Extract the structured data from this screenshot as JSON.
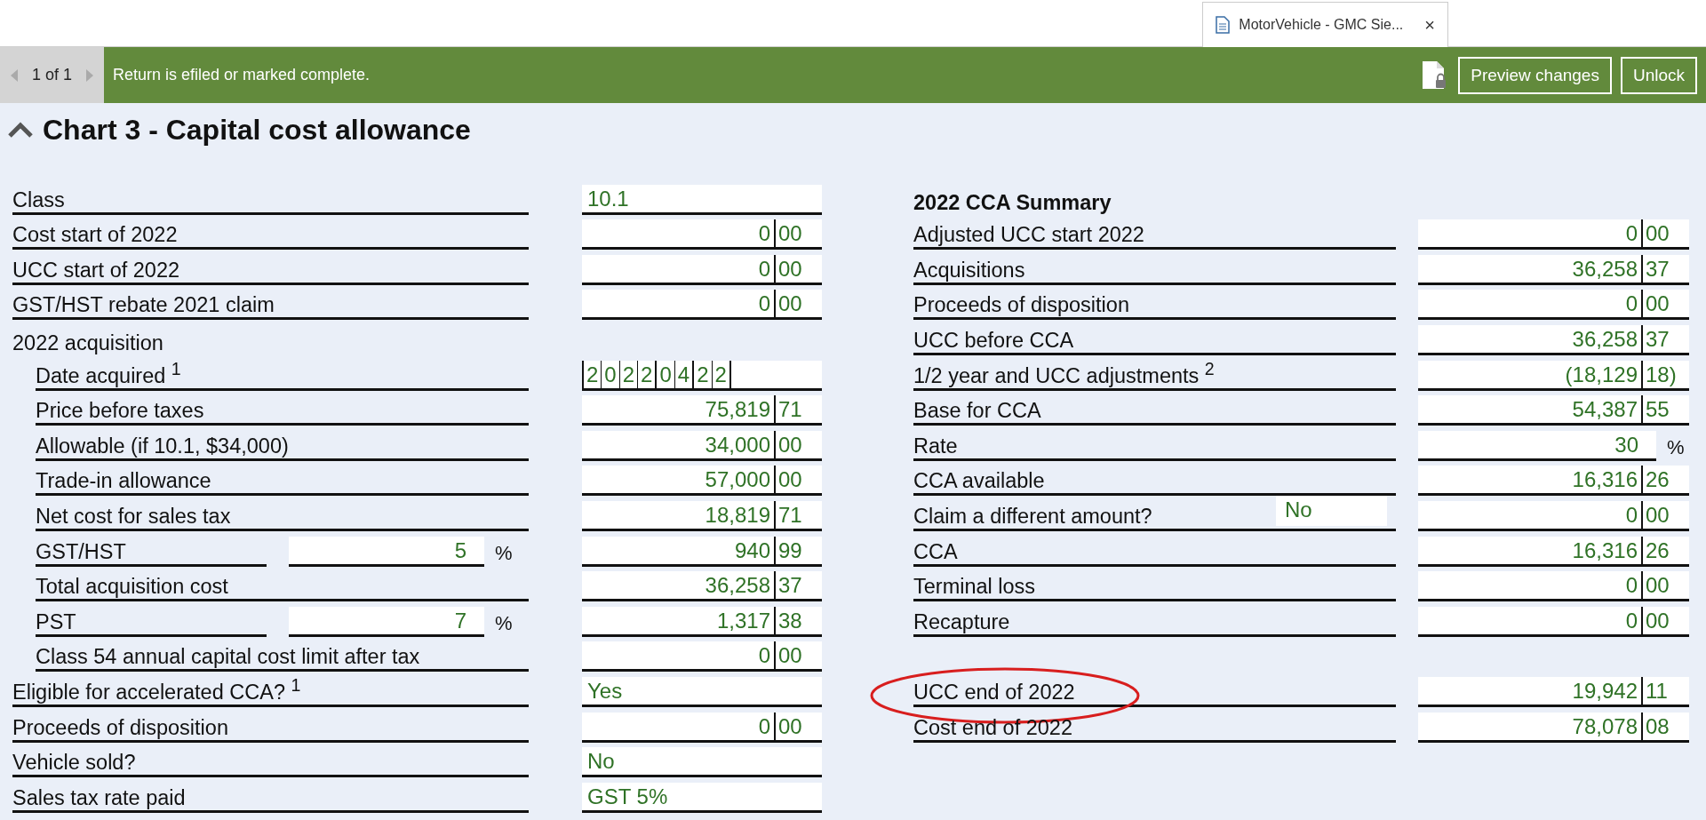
{
  "tab": {
    "title": "MotorVehicle - GMC Sie...",
    "close": "×"
  },
  "status_bar": {
    "pager": "1 of 1",
    "message": "Return is efiled or marked complete.",
    "buttons": [
      "Preview changes",
      "Unlock"
    ]
  },
  "form": {
    "title": "Chart 3 - Capital cost allowance",
    "expanded": true,
    "left_rows": [
      {
        "kind": "text",
        "label": "Class",
        "indent": false,
        "value": "10.1"
      },
      {
        "kind": "amount",
        "label": "Cost start of 2022",
        "indent": false,
        "dollars": "0",
        "cents": "00"
      },
      {
        "kind": "amount",
        "label": "UCC start of 2022",
        "indent": false,
        "dollars": "0",
        "cents": "00"
      },
      {
        "kind": "amount",
        "label": "GST/HST rebate 2021 claim",
        "indent": false,
        "dollars": "0",
        "cents": "00"
      },
      {
        "kind": "heading",
        "label": "2022 acquisition",
        "indent": false
      },
      {
        "kind": "date",
        "label": "Date acquired $^{1}$",
        "indent": true,
        "groups": [
          "2022",
          "04",
          "22"
        ]
      },
      {
        "kind": "amount",
        "label": "Price before taxes",
        "indent": true,
        "dollars": "75,819",
        "cents": "71"
      },
      {
        "kind": "amount",
        "label": "Allowable (if 10.1, $34,000)",
        "indent": true,
        "dollars": "34,000",
        "cents": "00"
      },
      {
        "kind": "amount",
        "label": "Trade-in allowance",
        "indent": true,
        "dollars": "57,000",
        "cents": "00"
      },
      {
        "kind": "amount",
        "label": "Net cost for sales tax",
        "indent": true,
        "dollars": "18,819",
        "cents": "71"
      },
      {
        "kind": "percent_amount",
        "label": "GST/HST",
        "indent": true,
        "percent": "5",
        "unit": "%",
        "dollars": "940",
        "cents": "99"
      },
      {
        "kind": "amount",
        "label": "Total acquisition cost",
        "indent": true,
        "dollars": "36,258",
        "cents": "37"
      },
      {
        "kind": "percent_amount",
        "label": "PST",
        "indent": true,
        "percent": "7",
        "unit": "%",
        "dollars": "1,317",
        "cents": "38"
      },
      {
        "kind": "amount",
        "label": "Class 54 annual capital cost limit after tax",
        "indent": true,
        "dollars": "0",
        "cents": "00"
      },
      {
        "kind": "text",
        "label": "Eligible for accelerated CCA? $^{1}$",
        "indent": false,
        "value": "Yes"
      },
      {
        "kind": "amount",
        "label": "Proceeds of disposition",
        "indent": false,
        "dollars": "0",
        "cents": "00"
      },
      {
        "kind": "text",
        "label": "Vehicle sold?",
        "indent": false,
        "value": "No"
      },
      {
        "kind": "text",
        "label": "Sales tax rate paid",
        "indent": false,
        "value": "GST 5%"
      }
    ],
    "summary_title": "2022 CCA Summary",
    "right_rows": [
      {
        "kind": "amount",
        "label": "Adjusted UCC start 2022",
        "circled": false,
        "dollars": "0",
        "cents": "00"
      },
      {
        "kind": "amount",
        "label": "Acquisitions",
        "circled": false,
        "dollars": "36,258",
        "cents": "37"
      },
      {
        "kind": "amount",
        "label": "Proceeds of disposition",
        "circled": false,
        "dollars": "0",
        "cents": "00"
      },
      {
        "kind": "amount",
        "label": "UCC before CCA",
        "circled": false,
        "dollars": "36,258",
        "cents": "37"
      },
      {
        "kind": "amount",
        "label": "1/2 year and UCC adjustments $^{2}$",
        "circled": false,
        "dollars": "(18,129",
        "cents": "18)"
      },
      {
        "kind": "amount",
        "label": "Base for CCA",
        "circled": false,
        "dollars": "54,387",
        "cents": "55"
      },
      {
        "kind": "percent",
        "label": "Rate",
        "circled": false,
        "percent": "30",
        "unit": "%"
      },
      {
        "kind": "amount",
        "label": "CCA available",
        "circled": false,
        "dollars": "16,316",
        "cents": "26"
      },
      {
        "kind": "choice_amount",
        "label": "Claim a different amount?",
        "circled": false,
        "choice": "No",
        "dollars": "0",
        "cents": "00"
      },
      {
        "kind": "amount",
        "label": "CCA",
        "circled": false,
        "dollars": "16,316",
        "cents": "26"
      },
      {
        "kind": "amount",
        "label": "Terminal loss",
        "circled": false,
        "dollars": "0",
        "cents": "00"
      },
      {
        "kind": "amount",
        "label": "Recapture",
        "circled": false,
        "dollars": "0",
        "cents": "00"
      },
      {
        "kind": "spacer",
        "circled": false
      },
      {
        "kind": "amount",
        "label": "UCC end of 2022",
        "circled": true,
        "dollars": "19,942",
        "cents": "11"
      },
      {
        "kind": "amount",
        "label": "Cost end of 2022",
        "circled": false,
        "dollars": "78,078",
        "cents": "08"
      }
    ]
  }
}
